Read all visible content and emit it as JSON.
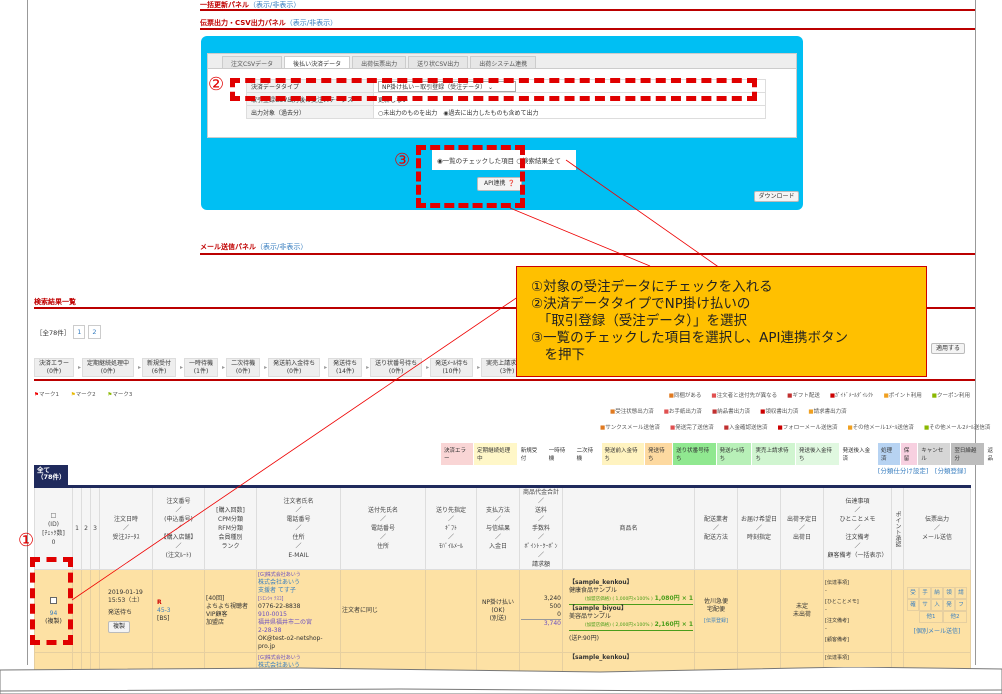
{
  "panels": {
    "bulk_update": {
      "title": "一括更新パネル",
      "toggle": "（表示/非表示）"
    },
    "slip_output": {
      "title": "伝票出力・CSV出力パネル",
      "toggle": "（表示/非表示）"
    },
    "mail_send": {
      "title": "メール送信パネル",
      "toggle": "（表示/非表示）"
    }
  },
  "export_panel": {
    "tabs": [
      "注文CSVデータ",
      "後払い決済データ",
      "出荷伝票出力",
      "送り状CSV出力",
      "出荷システム連携"
    ],
    "active_tab": "後払い決済データ",
    "rows": [
      {
        "label": "決済データタイプ",
        "value": "NP掛け払い－取引登録（受注データ）"
      },
      {
        "label": "取引登録CSV出力後の受注ステータス",
        "value": "更新しない"
      },
      {
        "label": "出力対象（過去分）",
        "option1": "○未出力のものを出力",
        "option2": "◉過去に出力したものも含めて出力"
      }
    ],
    "scope_options": [
      "◉一覧のチェックした項目",
      "○検索結果全て"
    ],
    "api_button": "API連携",
    "download_button": "ダウンロード"
  },
  "annotations": {
    "step1": "①",
    "step2": "②",
    "step3": "③"
  },
  "callout": {
    "lines": [
      "①対象の受注データにチェックを入れる",
      "②決済データタイプでNP掛け払いの",
      "　「取引登録（受注データ）」を選択",
      "③一覧のチェックした項目を選択し、API連携ボタン",
      "　を押下"
    ]
  },
  "results": {
    "title": "検索結果一覧",
    "total": "［全78件］",
    "pages": [
      "1",
      "2"
    ],
    "apply_button": "適用する",
    "flow": [
      {
        "label": "決済エラー",
        "count": "(0件)"
      },
      {
        "label": "定期継続処理中",
        "count": "(0件)"
      },
      {
        "label": "新規受付",
        "count": "(6件)"
      },
      {
        "label": "一時待機",
        "count": "(1件)"
      },
      {
        "label": "二次待機",
        "count": "(0件)"
      },
      {
        "label": "発送前入金待ち",
        "count": "(0件)"
      },
      {
        "label": "発送待ち",
        "count": "(14件)"
      },
      {
        "label": "送り状番号待ち",
        "count": "(0件)"
      },
      {
        "label": "発送ﾒｰﾙ待ち",
        "count": "(10件)"
      },
      {
        "label": "実売上請求待ち",
        "count": "(3件)"
      },
      {
        "label": "発送後入",
        "count": "(0件"
      }
    ],
    "marks": [
      "マーク1",
      "マーク2",
      "マーク3"
    ],
    "icon_legend_1": [
      "同梱がある",
      "注文者と送付先が異なる",
      "ギフト配送",
      "ｶﾞｲﾄﾞﾒｰﾙﾀﾞｲﾚｸﾄ",
      "ポイント利用",
      "クーポン利用"
    ],
    "icon_legend_2": [
      "受注状態出力済",
      "お手紙出力済",
      "納品書出力済",
      "領収書出力済",
      "請求書出力済"
    ],
    "icon_legend_3": [
      "サンクスメール送信済",
      "発送完了送信済",
      "入金確認送信済",
      "フォローメール送信済",
      "その他メール1ﾒｰﾙ送信済",
      "その他メール2ﾒｰﾙ送信済"
    ],
    "status_legend": [
      {
        "label": "決済エラー",
        "color": "#f9d5d5"
      },
      {
        "label": "定期継続処理中",
        "color": "#fff7c8"
      },
      {
        "label": "新規受付",
        "color": "#ffffff"
      },
      {
        "label": "一時待機",
        "color": "#ffffff"
      },
      {
        "label": "二次待機",
        "color": "#ffffff"
      },
      {
        "label": "発送前入金待ち",
        "color": "#fff3c0"
      },
      {
        "label": "発送待ち",
        "color": "#fdd9a0"
      },
      {
        "label": "送り状番号待ち",
        "color": "#90e890"
      },
      {
        "label": "発送ﾒｰﾙ待ち",
        "color": "#b8f0b8"
      },
      {
        "label": "実売上請求待ち",
        "color": "#d0f5d0"
      },
      {
        "label": "発送後入金待ち",
        "color": "#e0f8e0"
      },
      {
        "label": "発送後入金済",
        "color": "#ffffff"
      },
      {
        "label": "処理済",
        "color": "#b7d3f2"
      },
      {
        "label": "保留",
        "color": "#f7d0e0"
      },
      {
        "label": "キャンセル",
        "color": "#d6d6d6"
      },
      {
        "label": "翌日繰越分",
        "color": "#bdbdbd"
      },
      {
        "label": "返品",
        "color": "#ffffff"
      }
    ],
    "links": [
      "[分類仕分け設定]",
      "[分類登録]"
    ],
    "all_tab": {
      "label": "全て",
      "count": "（78件）"
    },
    "headers": {
      "id": [
        "□",
        "(ID)",
        "[ﾁｪｯｸ数]",
        "0"
      ],
      "n1": "1",
      "n2": "2",
      "n3": "3",
      "date": [
        "注文日時",
        "／",
        "受注ｽﾃｰﾀｽ"
      ],
      "order_no": [
        "注文番号",
        "／",
        "(申込番号)",
        "／",
        "【購入店舗】",
        "／",
        "(注文ﾙｰﾄ)"
      ],
      "purchase": [
        "[購入回数]",
        "CPM分類",
        "RFM分類",
        "会員種別",
        "ランク"
      ],
      "customer": [
        "注文者氏名",
        "／",
        "電話番号",
        "／",
        "住所",
        "／",
        "E-MAIL"
      ],
      "recipient": [
        "送付先氏名",
        "／",
        "電話番号",
        "／",
        "住所"
      ],
      "dest": [
        "送り先指定",
        "／",
        "ｷﾞﾌﾄ",
        "／",
        "ﾓﾊﾞｲﾙﾒｰﾙ"
      ],
      "payment": [
        "支払方法",
        "／",
        "与信結果",
        "／",
        "入金日"
      ],
      "amount": [
        "商品代金合計",
        "／",
        "送料",
        "／",
        "手数料",
        "／",
        "ﾎﾟｲﾝﾄ･ｸｰﾎﾟﾝ",
        "／",
        "請求額"
      ],
      "product": "商品名",
      "carrier": [
        "配送業者",
        "／",
        "配送方法"
      ],
      "delivery": [
        "お届け希望日",
        "／",
        "時刻指定"
      ],
      "ship": [
        "出荷予定日",
        "／",
        "出荷日"
      ],
      "memo": [
        "伝達事項",
        "／",
        "ひとことメモ",
        "／",
        "注文備考",
        "／",
        "顧客備考（一括表示）"
      ],
      "point": "ポイント承認",
      "slip": [
        "伝票出力",
        "／",
        "メール送信"
      ]
    },
    "rows": [
      {
        "id": "94",
        "id_note": "(複製)",
        "date": "2019-01-19",
        "time": "15:53（土）",
        "status": "発送待ち",
        "copy_btn": "複製",
        "order_no": "45-3",
        "shop": "[BS]",
        "purchase": [
          "[40回]",
          "よちよち視聴者",
          "VIP顧客",
          "加盟店"
        ],
        "customer": {
          "company_kana": "[G]株式会社あいう",
          "company": "株式会社あいう",
          "name": "支援者 てす子",
          "kana": "[ｼｴﾝｼｬ ﾃｽｺ]",
          "tel": "0776-22-8838",
          "zip": "910-0015",
          "addr1": "福井県福井市二の宮",
          "addr2": "2-28-38",
          "email": "OK@test-o2-netshop-pro.jp"
        },
        "recipient": "注文者に同じ",
        "payment": [
          "NP掛け払い",
          "(OK)",
          "(別送)"
        ],
        "amount": [
          "3,240",
          "500",
          "0",
          "3,740"
        ],
        "products": [
          {
            "code": "【sample_kenkou】",
            "name": "健康食品サンプル",
            "detail": "(加盟店価格) ( 1,000円×100% )",
            "price": "1,080円 × 1"
          },
          {
            "code": "【sample_biyou】",
            "name": "美容品サンプル",
            "detail": "(加盟店価格) ( 2,000円×100% )",
            "price": "2,160円 × 1"
          }
        ],
        "shipping_note": "(送P:90円)",
        "carrier": [
          "佐川急便",
          "宅配便"
        ],
        "carrier_link": "[伝票登録]",
        "ship": [
          "未定",
          "未出荷"
        ],
        "memo": [
          "[伝達事項]",
          "-",
          "[ひとことメモ]",
          "-",
          "[注文備考]",
          "-",
          "[顧客備考]"
        ],
        "slip_marks": [
          "受",
          "手",
          "納",
          "領",
          "請",
          "確",
          "サ",
          "入",
          "発",
          "フ",
          "他1",
          "他2"
        ],
        "mail_link": "[個別メール送信]"
      }
    ],
    "next_row": {
      "company_kana": "[G]株式会社あいう",
      "company": "株式会社あいう",
      "product": "【sample_kenkou】",
      "memo": "[伝達事項]"
    }
  }
}
